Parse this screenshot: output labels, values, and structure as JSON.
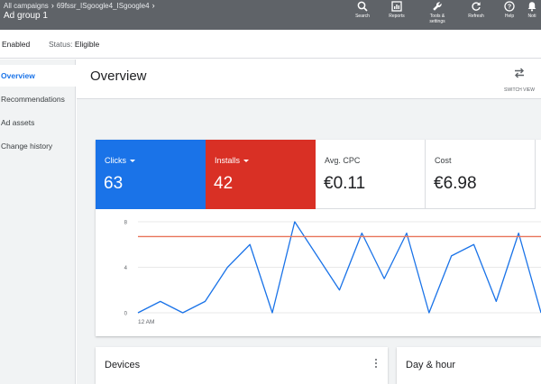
{
  "topbar": {
    "breadcrumb": [
      "All campaigns",
      "69fssr_ISgoogle4_ISgoogle4"
    ],
    "ad_group": "Ad group 1",
    "tools": [
      {
        "label": "Search",
        "icon": "search-icon"
      },
      {
        "label": "Reports",
        "icon": "reports-icon"
      },
      {
        "label": "Tools & settings",
        "icon": "wrench-icon"
      },
      {
        "label": "Refresh",
        "icon": "refresh-icon"
      },
      {
        "label": "Help",
        "icon": "help-icon"
      },
      {
        "label": "Noti",
        "icon": "bell-icon"
      }
    ]
  },
  "status_bar": {
    "enabled": "Enabled",
    "status_label": "Status:",
    "status_value": "Eligible"
  },
  "sidebar": {
    "items": [
      {
        "label": "Overview",
        "active": true
      },
      {
        "label": "Recommendations",
        "active": false
      },
      {
        "label": "Ad assets",
        "active": false
      },
      {
        "label": "Change history",
        "active": false
      }
    ]
  },
  "header": {
    "title": "Overview",
    "switch_view": "SWITCH VIEW"
  },
  "metrics": {
    "clicks": {
      "label": "Clicks",
      "value": "63",
      "color": "#1a73e8"
    },
    "installs": {
      "label": "Installs",
      "value": "42",
      "color": "#d93025"
    },
    "avg_cpc": {
      "label": "Avg. CPC",
      "value": "€0.11"
    },
    "cost": {
      "label": "Cost",
      "value": "€6.98"
    }
  },
  "chart_data": {
    "type": "line",
    "yticks": [
      0,
      4,
      8
    ],
    "ylim": [
      0,
      8
    ],
    "xlabel_first": "12 AM",
    "series": [
      {
        "color": "#1a73e8",
        "values": [
          0,
          1,
          0,
          1,
          4,
          6,
          0,
          8,
          5,
          2,
          7,
          3,
          7,
          0,
          5,
          6,
          1,
          7,
          0
        ]
      },
      {
        "color": "#e8745a",
        "values": [
          6.7,
          6.7,
          6.7,
          6.7,
          6.7,
          6.7,
          6.7,
          6.7,
          6.7,
          6.7,
          6.7,
          6.7,
          6.7,
          6.7,
          6.7,
          6.7,
          6.7,
          6.7,
          6.7
        ]
      }
    ]
  },
  "cards": {
    "devices": "Devices",
    "day_hour": "Day & hour"
  }
}
